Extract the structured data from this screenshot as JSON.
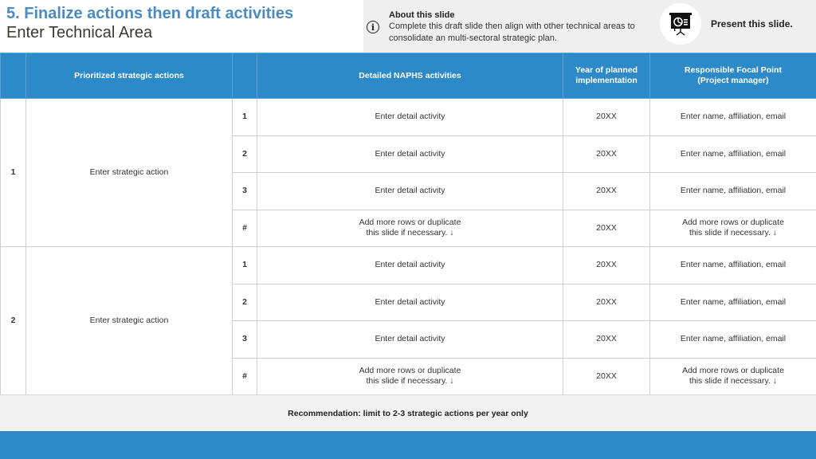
{
  "header": {
    "title": "5. Finalize actions then draft activities",
    "subtitle": "Enter Technical Area",
    "about": {
      "icon": "info-icon",
      "title": "About this slide",
      "text": "Complete this draft slide then align with other technical areas to consolidate an multi-sectoral strategic plan."
    },
    "present": {
      "icon": "presentation-board-icon",
      "label": "Present this slide."
    }
  },
  "colors": {
    "accent_blue": "#2d8ac9",
    "title_blue": "#4a8bc4",
    "panel_gray": "#efeff0"
  },
  "table": {
    "columns": [
      "",
      "Prioritized strategic actions",
      "",
      "Detailed NAPHS activities",
      "Year of planned implementation",
      "Responsible Focal Point (Project manager)"
    ],
    "column_lines": {
      "year": [
        "Year of planned",
        "implementation"
      ],
      "focal": [
        "Responsible Focal Point",
        "(Project manager)"
      ]
    },
    "groups": [
      {
        "number": "1",
        "strategic_action": "Enter strategic action",
        "rows": [
          {
            "num": "1",
            "activity": [
              "Enter detail activity"
            ],
            "year": "20XX",
            "focal": [
              "Enter name, affiliation, email"
            ]
          },
          {
            "num": "2",
            "activity": [
              "Enter detail activity"
            ],
            "year": "20XX",
            "focal": [
              "Enter name, affiliation, email"
            ]
          },
          {
            "num": "3",
            "activity": [
              "Enter detail activity"
            ],
            "year": "20XX",
            "focal": [
              "Enter name, affiliation, email"
            ]
          },
          {
            "num": "#",
            "activity": [
              "Add more rows or duplicate",
              "this slide if necessary. ↓"
            ],
            "year": "20XX",
            "focal": [
              "Add more rows or duplicate",
              "this slide if necessary. ↓"
            ]
          }
        ]
      },
      {
        "number": "2",
        "strategic_action": "Enter strategic action",
        "rows": [
          {
            "num": "1",
            "activity": [
              "Enter detail activity"
            ],
            "year": "20XX",
            "focal": [
              "Enter name, affiliation, email"
            ]
          },
          {
            "num": "2",
            "activity": [
              "Enter detail activity"
            ],
            "year": "20XX",
            "focal": [
              "Enter name, affiliation, email"
            ]
          },
          {
            "num": "3",
            "activity": [
              "Enter detail activity"
            ],
            "year": "20XX",
            "focal": [
              "Enter name, affiliation, email"
            ]
          },
          {
            "num": "#",
            "activity": [
              "Add more rows or duplicate",
              "this slide if necessary. ↓"
            ],
            "year": "20XX",
            "focal": [
              "Add more rows or duplicate",
              "this slide if necessary. ↓"
            ]
          }
        ]
      }
    ]
  },
  "recommendation": "Recommendation: limit to 2-3 strategic actions per year only"
}
